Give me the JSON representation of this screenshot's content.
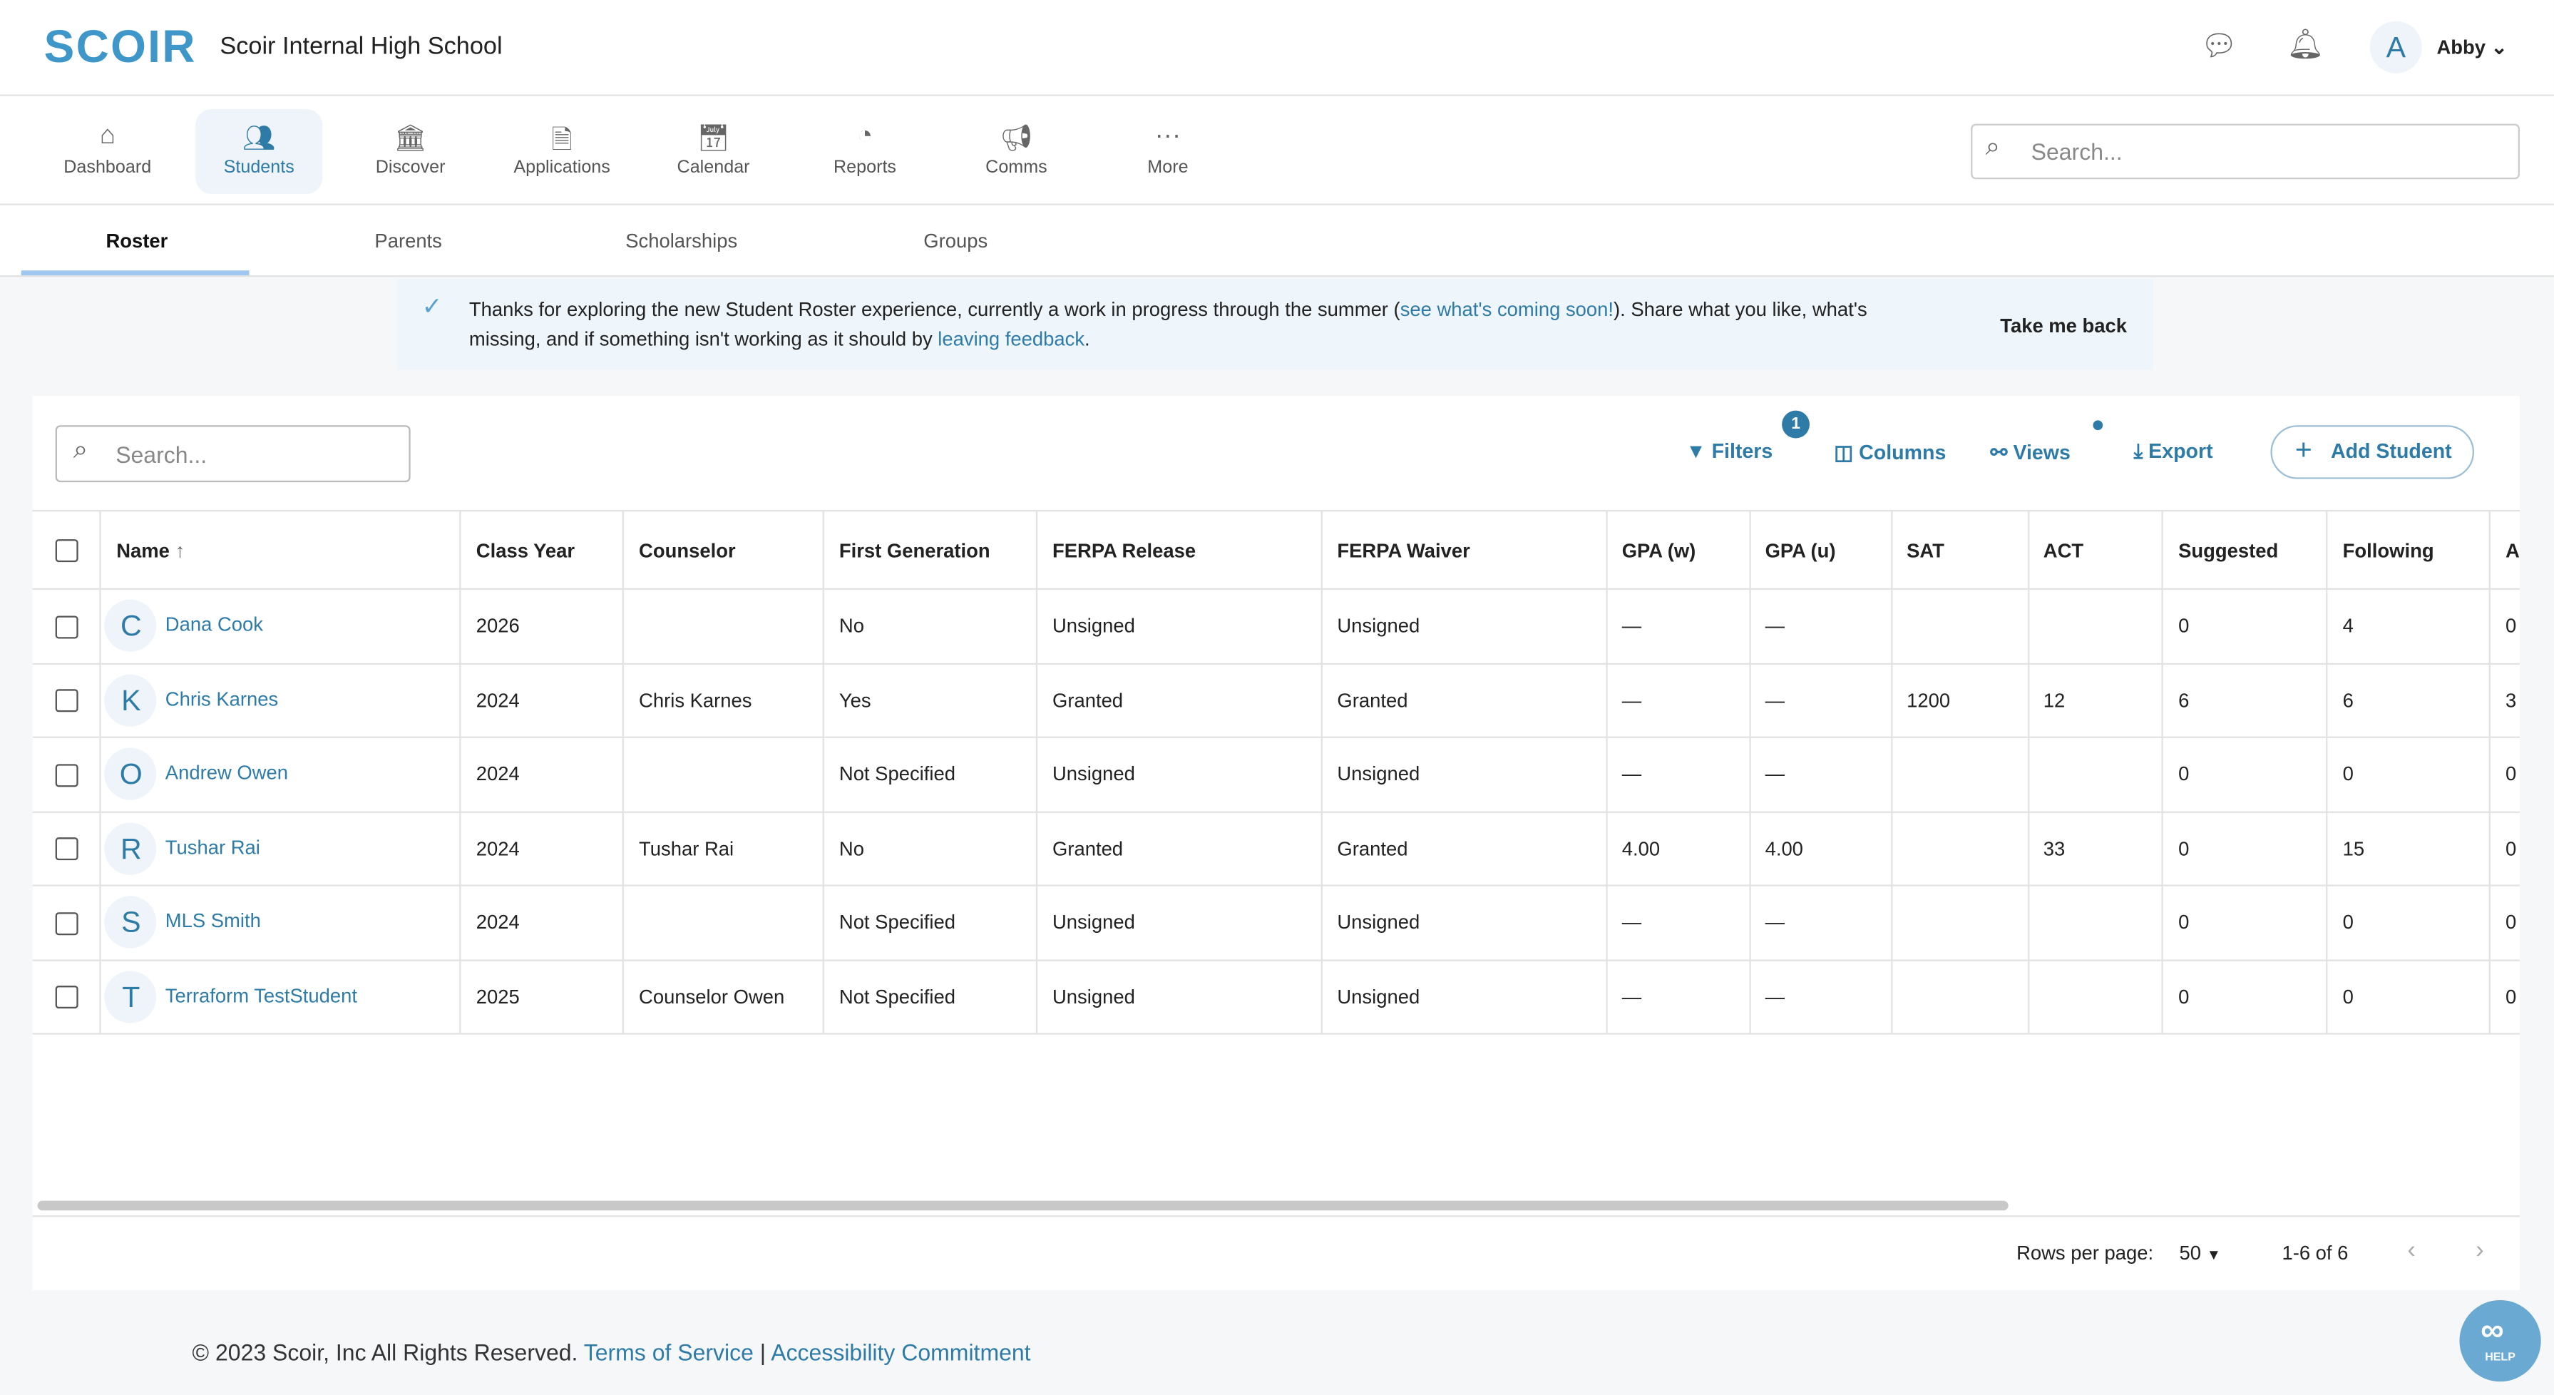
{
  "header": {
    "logo": "SCOIR",
    "school": "Scoir Internal High School",
    "user_initial": "A",
    "user_name": "Abby"
  },
  "nav": {
    "items": [
      {
        "label": "Dashboard",
        "icon": "home-icon"
      },
      {
        "label": "Students",
        "icon": "users-icon",
        "active": true
      },
      {
        "label": "Discover",
        "icon": "school-icon"
      },
      {
        "label": "Applications",
        "icon": "document-icon"
      },
      {
        "label": "Calendar",
        "icon": "calendar-icon"
      },
      {
        "label": "Reports",
        "icon": "pie-chart-icon"
      },
      {
        "label": "Comms",
        "icon": "megaphone-icon"
      },
      {
        "label": "More",
        "icon": "more-icon"
      }
    ],
    "search_placeholder": "Search..."
  },
  "subtabs": [
    "Roster",
    "Parents",
    "Scholarships",
    "Groups"
  ],
  "banner": {
    "text1": "Thanks for exploring the new Student Roster experience, currently a work in progress through the summer (",
    "link1": "see what's coming soon!",
    "text2": "). Share what you like, what's missing, and if something isn't working as it should by ",
    "link2": "leaving feedback",
    "text3": ".",
    "action": "Take me back"
  },
  "toolbar": {
    "search_placeholder": "Search...",
    "filters": "Filters",
    "filter_count": "1",
    "columns": "Columns",
    "views": "Views",
    "export": "Export",
    "add_student": "Add Student"
  },
  "table": {
    "columns": [
      "Name",
      "Class Year",
      "Counselor",
      "First Generation",
      "FERPA Release",
      "FERPA Waiver",
      "GPA (w)",
      "GPA (u)",
      "SAT",
      "ACT",
      "Suggested",
      "Following",
      "A"
    ],
    "rows": [
      [
        "C",
        "Dana Cook",
        "2026",
        "",
        "No",
        "Unsigned",
        "Unsigned",
        "—",
        "—",
        "",
        "",
        "0",
        "4",
        "0"
      ],
      [
        "K",
        "Chris Karnes",
        "2024",
        "Chris Karnes",
        "Yes",
        "Granted",
        "Granted",
        "—",
        "—",
        "1200",
        "12",
        "6",
        "6",
        "3"
      ],
      [
        "O",
        "Andrew Owen",
        "2024",
        "",
        "Not Specified",
        "Unsigned",
        "Unsigned",
        "—",
        "—",
        "",
        "",
        "0",
        "0",
        "0"
      ],
      [
        "R",
        "Tushar Rai",
        "2024",
        "Tushar Rai",
        "No",
        "Granted",
        "Granted",
        "4.00",
        "4.00",
        "",
        "33",
        "0",
        "15",
        "0"
      ],
      [
        "S",
        "MLS Smith",
        "2024",
        "",
        "Not Specified",
        "Unsigned",
        "Unsigned",
        "—",
        "—",
        "",
        "",
        "0",
        "0",
        "0"
      ],
      [
        "T",
        "Terraform TestStudent",
        "2025",
        "Counselor Owen",
        "Not Specified",
        "Unsigned",
        "Unsigned",
        "—",
        "—",
        "",
        "",
        "0",
        "0",
        "0"
      ]
    ]
  },
  "pagination": {
    "rows_label": "Rows per page:",
    "rows_value": "50",
    "range": "1-6 of 6"
  },
  "footer": {
    "copyright": "© 2023 Scoir, Inc All Rights Reserved.",
    "terms": "Terms of Service",
    "sep": "|",
    "accessibility": "Accessibility Commitment"
  },
  "help": "HELP",
  "colors": {
    "accent": "#2f7ba8",
    "logo": "#3e97c8"
  }
}
